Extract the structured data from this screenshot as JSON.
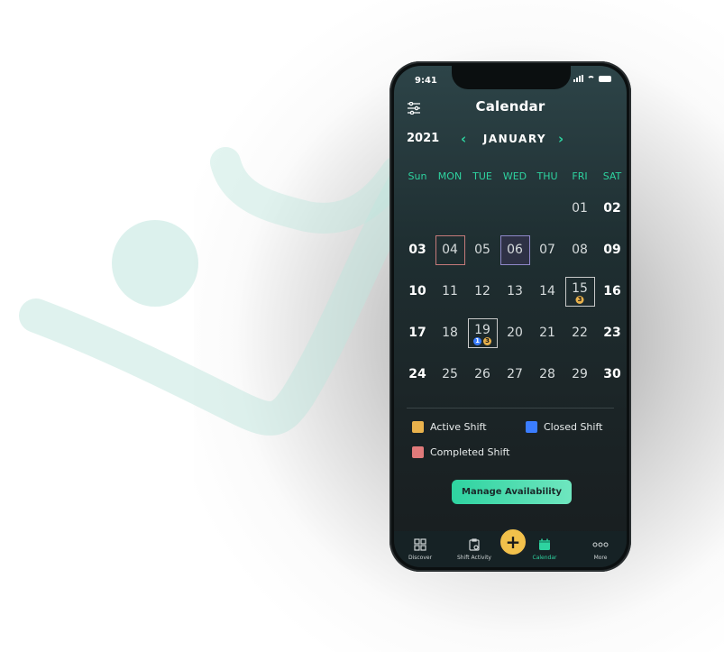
{
  "status": {
    "time": "9:41"
  },
  "header": {
    "title": "Calendar"
  },
  "nav": {
    "year": "2021",
    "month": "JANUARY",
    "prev": "‹",
    "next": "›"
  },
  "weekdays": [
    "Sun",
    "MON",
    "TUE",
    "WED",
    "THU",
    "FRI",
    "SAT"
  ],
  "weeks": [
    [
      "",
      "",
      "",
      "",
      "",
      "01",
      "02"
    ],
    [
      "03",
      "04",
      "05",
      "06",
      "07",
      "08",
      "09"
    ],
    [
      "10",
      "11",
      "12",
      "13",
      "14",
      "15",
      "16"
    ],
    [
      "17",
      "18",
      "19",
      "20",
      "21",
      "22",
      "23"
    ],
    [
      "24",
      "25",
      "26",
      "27",
      "28",
      "29",
      "30"
    ]
  ],
  "badges": {
    "day15": [
      "3"
    ],
    "day19": [
      "1",
      "3"
    ]
  },
  "legend": {
    "active": "Active Shift",
    "closed": "Closed Shift",
    "completed": "Completed Shift"
  },
  "colors": {
    "active": "#e9b24c",
    "closed": "#3b7dff",
    "completed": "#e07a7a",
    "accent": "#2ed3a0"
  },
  "manage_button": "Manage Availability",
  "fab_label": "+",
  "tabs": {
    "discover": "Discover",
    "shift_activity": "Shift Activity",
    "calendar": "Calendar",
    "more": "More"
  }
}
